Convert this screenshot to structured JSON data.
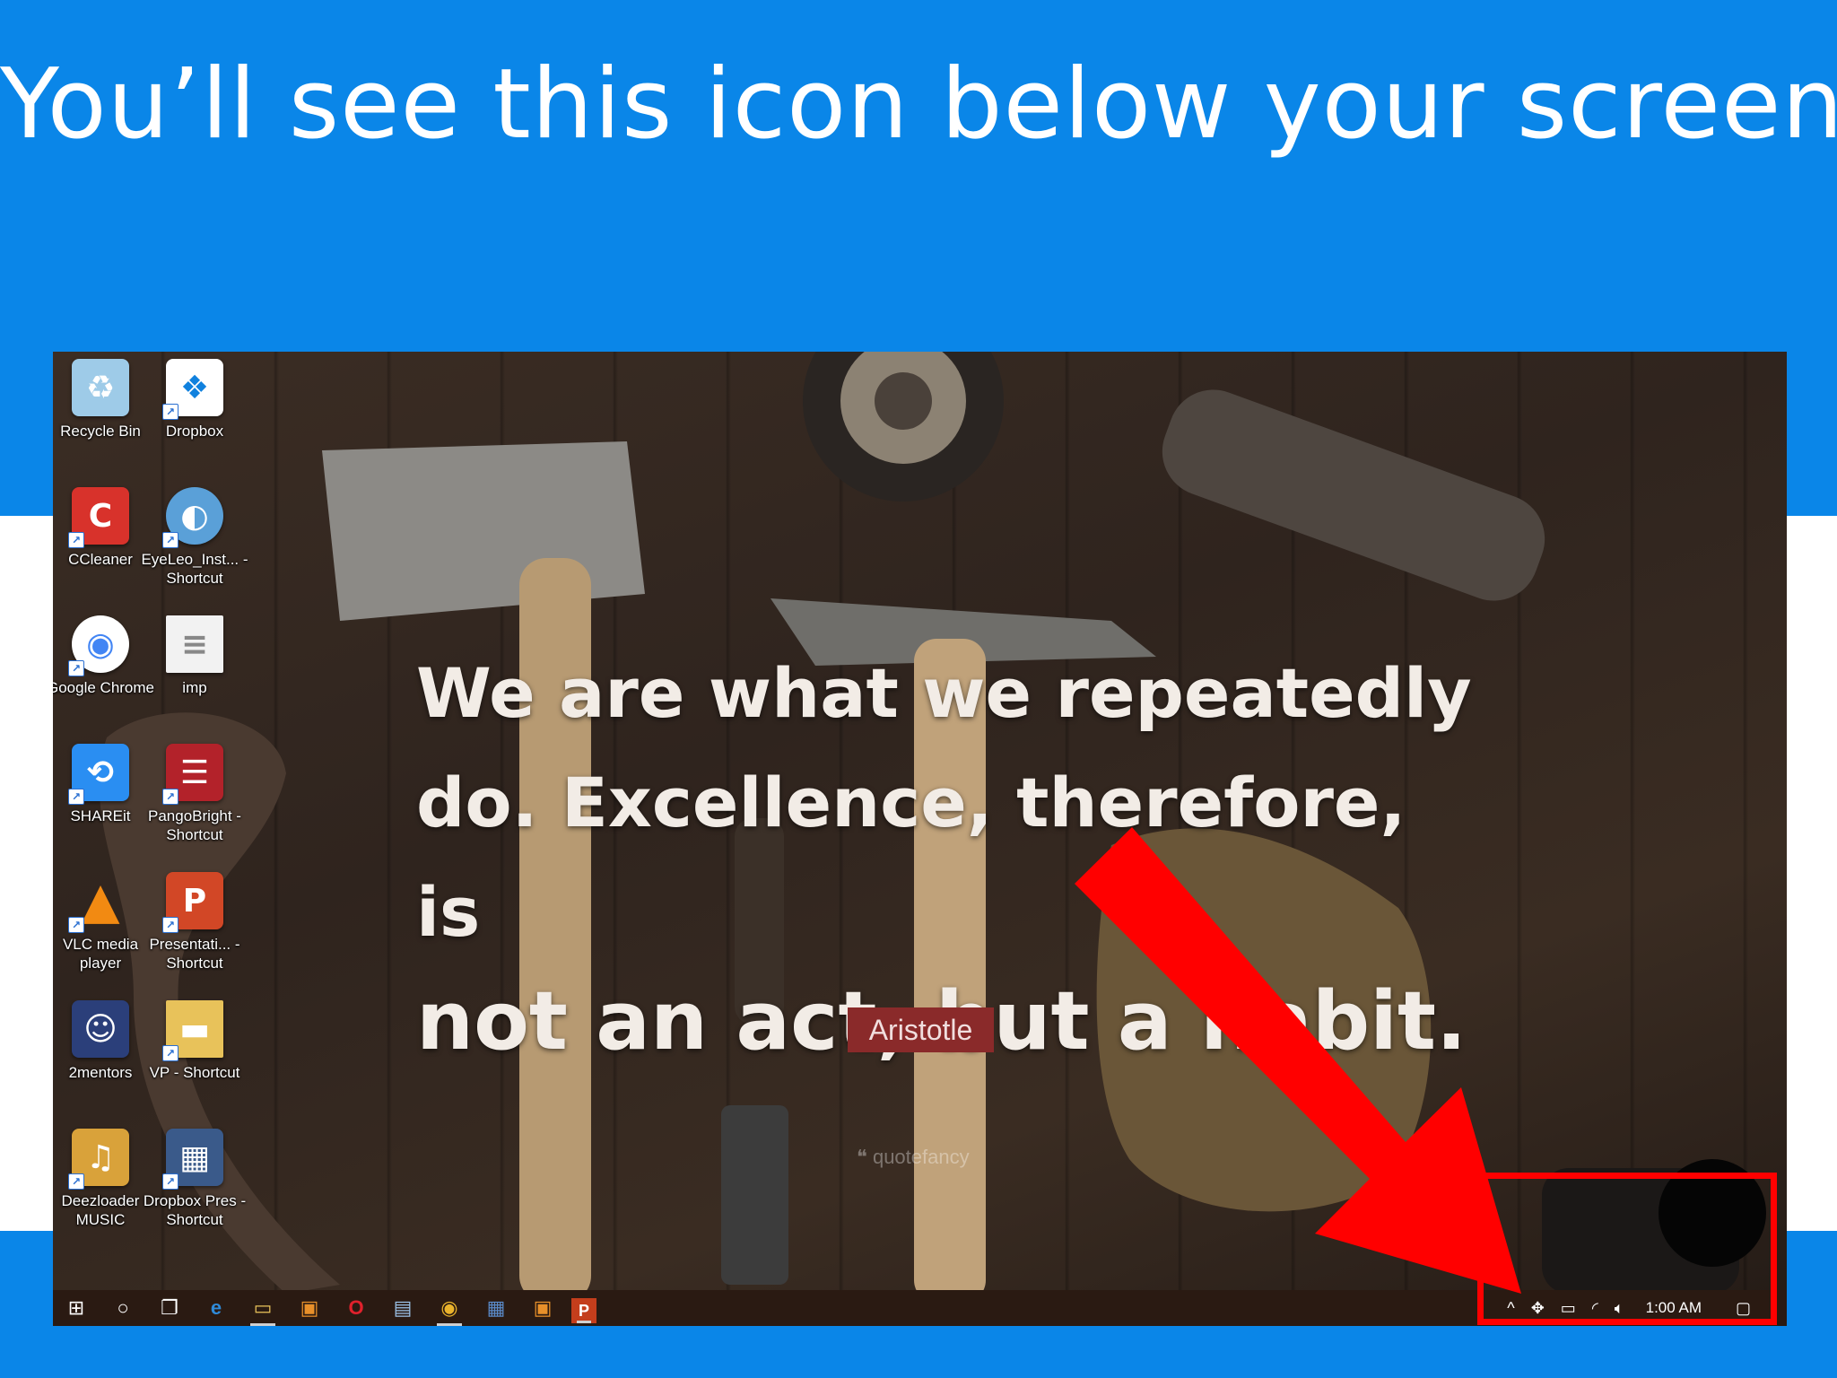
{
  "slide": {
    "title": "You’ll see this icon below your screen",
    "colors": {
      "band": "#0a86e8",
      "highlight": "#ff0000"
    }
  },
  "desktop": {
    "icons": [
      {
        "label": "Recycle Bin",
        "icon": "recycle-bin-icon",
        "color": "#9ecbe8"
      },
      {
        "label": "Dropbox",
        "icon": "dropbox-icon",
        "color": "#1081de"
      },
      {
        "label": "CCleaner",
        "icon": "ccleaner-icon",
        "color": "#d8322b"
      },
      {
        "label": "EyeLeo_Inst... - Shortcut",
        "icon": "eyeleo-icon",
        "color": "#5aa0d8"
      },
      {
        "label": "Google Chrome",
        "icon": "chrome-icon",
        "color": "#dd4b39"
      },
      {
        "label": "imp",
        "icon": "text-file-icon",
        "color": "#f2f2f2"
      },
      {
        "label": "SHAREit",
        "icon": "shareit-icon",
        "color": "#2a8ef2"
      },
      {
        "label": "PangoBright - Shortcut",
        "icon": "pangobright-icon",
        "color": "#b3222a"
      },
      {
        "label": "VLC media player",
        "icon": "vlc-icon",
        "color": "#f28a12"
      },
      {
        "label": "Presentati... - Shortcut",
        "icon": "powerpoint-file-icon",
        "color": "#d24726"
      },
      {
        "label": "2mentors",
        "icon": "image-file-icon",
        "color": "#2b3f7a"
      },
      {
        "label": "VP - Shortcut",
        "icon": "folder-icon",
        "color": "#e8c25a"
      },
      {
        "label": "Deezloader MUSIC",
        "icon": "deezloader-icon",
        "color": "#d9a23a"
      },
      {
        "label": "Dropbox Pres - Shortcut",
        "icon": "presentation-file-icon",
        "color": "#3a5a8a"
      }
    ],
    "quote": {
      "line1": "We are what we repeatedly",
      "line2": "do. Excellence, therefore, is",
      "line3": "not an act, but a habit."
    },
    "author": "Aristotle",
    "watermark": "quotefancy"
  },
  "taskbar": {
    "items": [
      {
        "icon": "windows-start-icon",
        "glyph": "⊞"
      },
      {
        "icon": "cortana-search-icon",
        "glyph": "○"
      },
      {
        "icon": "task-view-icon",
        "glyph": "❐"
      },
      {
        "icon": "edge-browser-icon",
        "glyph": "e"
      },
      {
        "icon": "file-explorer-icon",
        "glyph": "▭"
      },
      {
        "icon": "store-icon",
        "glyph": "▣"
      },
      {
        "icon": "opera-browser-icon",
        "glyph": "O"
      },
      {
        "icon": "notepad-icon",
        "glyph": "▤"
      },
      {
        "icon": "chrome-taskbar-icon",
        "glyph": "◉"
      },
      {
        "icon": "monitor-app-icon",
        "glyph": "▦"
      },
      {
        "icon": "orange-app-icon",
        "glyph": "▣"
      },
      {
        "icon": "powerpoint-taskbar-icon",
        "glyph": "P"
      }
    ],
    "tray": {
      "chevron": "^",
      "clock": "1:00 AM"
    }
  }
}
